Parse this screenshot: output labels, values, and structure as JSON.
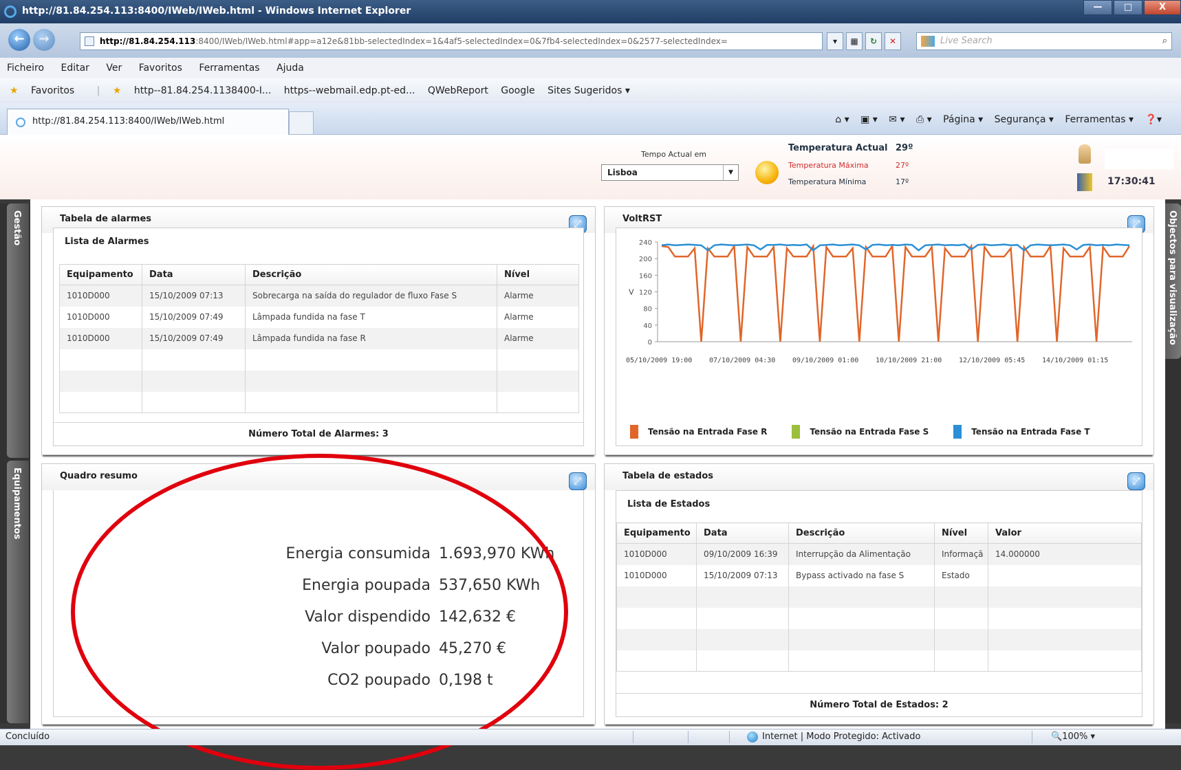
{
  "window": {
    "title": "http://81.84.254.113:8400/IWeb/IWeb.html - Windows Internet Explorer",
    "min": "—",
    "max": "□",
    "close": "X"
  },
  "address": {
    "host": "http://81.84.254.113",
    "rest": ":8400/IWeb/IWeb.html#app=a12e&81bb-selectedIndex=1&4af5-selectedIndex=0&7fb4-selectedIndex=0&2577-selectedIndex=",
    "refresh": "↻",
    "close": "✕",
    "search_placeholder": "Live Search"
  },
  "menu": [
    "Ficheiro",
    "Editar",
    "Ver",
    "Favoritos",
    "Ferramentas",
    "Ajuda"
  ],
  "favorites": {
    "label": "Favoritos",
    "items": [
      "http--81.84.254.1138400-I...",
      "https--webmail.edp.pt-ed...",
      "QWebReport",
      "Google",
      "Sites Sugeridos ▾"
    ]
  },
  "tab": {
    "label": "http://81.84.254.113:8400/IWeb/IWeb.html"
  },
  "commands": [
    "Página ▾",
    "Segurança ▾",
    "Ferramentas ▾"
  ],
  "weather": {
    "label": "Tempo Actual em",
    "city": "Lisboa",
    "current_label": "Temperatura Actual",
    "current": "29º",
    "max_label": "Temperatura Máxima",
    "max": "27º",
    "min_label": "Temperatura Mínima",
    "min": "17º",
    "time": "17:30:41"
  },
  "side": {
    "left": [
      "Gestão",
      "Equipamentos"
    ],
    "right": "Objectos para visualização"
  },
  "alarms": {
    "title": "Tabela de alarmes",
    "subtitle": "Lista de Alarmes",
    "columns": [
      "Equipamento",
      "Data",
      "Descrição",
      "Nível"
    ],
    "rows": [
      [
        "1010D000",
        "15/10/2009 07:13",
        "Sobrecarga na saída do regulador de fluxo Fase S",
        "Alarme"
      ],
      [
        "1010D000",
        "15/10/2009 07:49",
        "Lâmpada fundida na fase T",
        "Alarme"
      ],
      [
        "1010D000",
        "15/10/2009 07:49",
        "Lâmpada fundida na fase R",
        "Alarme"
      ]
    ],
    "total": "Número Total de Alarmes: 3"
  },
  "volt": {
    "title": "VoltRST"
  },
  "chart_data": {
    "type": "line",
    "ylabel": "V",
    "ylim": [
      0,
      240
    ],
    "yticks": [
      0,
      40,
      80,
      120,
      160,
      200,
      240
    ],
    "xticks": [
      "05/10/2009 19:00",
      "07/10/2009 04:30",
      "09/10/2009 01:00",
      "10/10/2009 21:00",
      "12/10/2009 05:45",
      "14/10/2009 01:15"
    ],
    "series": [
      {
        "name": "Tensão na Entrada Fase R",
        "color": "#e0662a",
        "values": [
          230,
          228,
          205,
          205,
          205,
          225,
          0,
          225,
          205,
          205,
          205,
          230,
          0,
          228,
          205,
          205,
          205,
          228,
          0,
          225,
          205,
          205,
          205,
          230,
          0,
          228,
          205,
          205,
          205,
          225,
          0,
          228,
          205,
          205,
          205,
          230,
          0,
          228,
          205,
          205,
          205,
          228,
          0,
          225,
          205,
          205,
          205,
          230,
          0,
          228,
          205,
          205,
          205,
          225,
          0,
          228,
          205,
          205,
          205,
          230,
          0,
          225,
          205,
          205,
          205,
          228,
          0,
          228,
          205,
          205,
          205,
          230
        ]
      },
      {
        "name": "Tensão na Entrada Fase S",
        "color": "#9cbf3c",
        "values": []
      },
      {
        "name": "Tensão na Entrada Fase T",
        "color": "#2a8fd6",
        "values": [
          232,
          234,
          232,
          233,
          234,
          233,
          232,
          220,
          232,
          234,
          233,
          232,
          233,
          234,
          232,
          222,
          233,
          233,
          234,
          232,
          233,
          232,
          234,
          220,
          232,
          233,
          234,
          232,
          233,
          234,
          232,
          222,
          233,
          234,
          232,
          233,
          232,
          234,
          233,
          220,
          232,
          233,
          234,
          232,
          233,
          232,
          234,
          222,
          233,
          234,
          232,
          233,
          234,
          232,
          233,
          220,
          232,
          234,
          233,
          232,
          233,
          234,
          232,
          222,
          233,
          234,
          232,
          233,
          232,
          234,
          233,
          232
        ]
      }
    ]
  },
  "summary": {
    "title": "Quadro resumo",
    "items": [
      {
        "label": "Energia consumida",
        "value": "1.693,970 KWh"
      },
      {
        "label": "Energia poupada",
        "value": "537,650 KWh"
      },
      {
        "label": "Valor dispendido",
        "value": "142,632 €"
      },
      {
        "label": "Valor poupado",
        "value": "45,270 €"
      },
      {
        "label": "CO2 poupado",
        "value": "0,198 t"
      }
    ]
  },
  "states": {
    "title": "Tabela de estados",
    "subtitle": "Lista de Estados",
    "columns": [
      "Equipamento",
      "Data",
      "Descrição",
      "Nível",
      "Valor"
    ],
    "rows": [
      [
        "1010D000",
        "09/10/2009 16:39",
        "Interrupção da Alimentação",
        "Informaçã",
        "14.000000"
      ],
      [
        "1010D000",
        "15/10/2009 07:13",
        "Bypass activado na fase S",
        "Estado",
        ""
      ]
    ],
    "total": "Número Total de Estados: 2"
  },
  "status": {
    "left": "Concluído",
    "zone": "Internet | Modo Protegido: Activado",
    "zoom": "🔍100%  ▾"
  }
}
